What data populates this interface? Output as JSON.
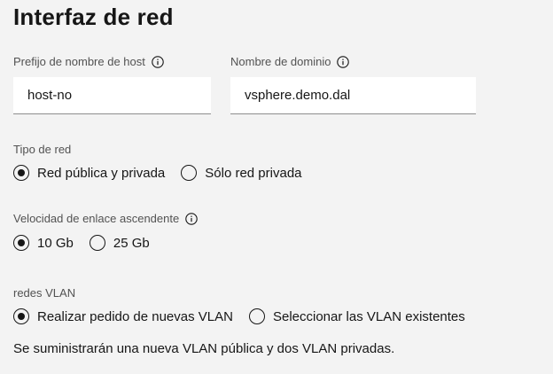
{
  "title": "Interfaz de red",
  "hostname": {
    "label": "Prefijo de nombre de host",
    "value": "host-no",
    "info_icon": "info-icon"
  },
  "domain": {
    "label": "Nombre de dominio",
    "value": "vsphere.demo.dal",
    "info_icon": "info-icon"
  },
  "network_type": {
    "label": "Tipo de red",
    "options": [
      {
        "label": "Red pública y privada",
        "selected": true
      },
      {
        "label": "Sólo red privada",
        "selected": false
      }
    ]
  },
  "uplink_speed": {
    "label": "Velocidad de enlace ascendente",
    "info_icon": "info-icon",
    "options": [
      {
        "label": "10 Gb",
        "selected": true
      },
      {
        "label": "25 Gb",
        "selected": false
      }
    ]
  },
  "vlans": {
    "label": "redes VLAN",
    "options": [
      {
        "label": "Realizar pedido de nuevas VLAN",
        "selected": true
      },
      {
        "label": "Seleccionar las VLAN existentes",
        "selected": false
      }
    ],
    "note": "Se suministrarán una nueva VLAN pública y dos VLAN privadas."
  }
}
